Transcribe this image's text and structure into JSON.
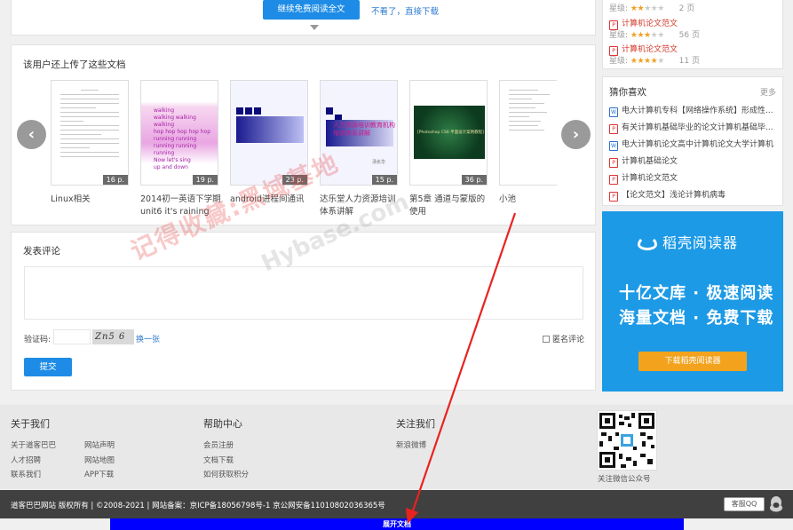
{
  "continue_panel": {
    "button_label": "继续免费阅读全文",
    "link_label": "不看了，直接下载"
  },
  "uploads": {
    "title": "该用户还上传了这些文档",
    "prev_label": "‹",
    "next_label": "›",
    "docs": [
      {
        "title": "Linux相关",
        "pages": "16 p."
      },
      {
        "title": "2014初一英语下学期unit6 it's raining",
        "pages": "19 p.",
        "thumb_text": "walking\nwalking walking walking\nhop hop hop hop hop\nrunning running\nrunning running running\nNow let's sing\nup and down"
      },
      {
        "title": "android进程间通讯",
        "pages": "23 p."
      },
      {
        "title": "达乐堂人力资源培训体系讲解",
        "pages": "15 p.",
        "thumb_text": "人力资源培训教育机构\n培训体系讲解",
        "thumb_sub": "汤长华"
      },
      {
        "title": "第5章 通道与蒙版的使用",
        "pages": "36 p.",
        "thumb_text": "[Photoshop CS6 平面设计案例教程]"
      },
      {
        "title": "小池",
        "pages": ""
      }
    ]
  },
  "comment": {
    "title": "发表评论",
    "captcha_label": "验证码:",
    "captcha_text": "Zn5 6",
    "refresh_label": "换一张",
    "anonymous_label": "匿名评论",
    "submit_label": "提交"
  },
  "right_top": {
    "items": [
      {
        "title": "",
        "rating_label": "星级:",
        "stars": 2,
        "pages": "2 页"
      },
      {
        "title": "计算机论文范文",
        "rating_label": "星级:",
        "stars": 3,
        "pages": "56 页"
      },
      {
        "title": "计算机论文范文",
        "rating_label": "星级:",
        "stars": 4,
        "pages": "11 页"
      }
    ]
  },
  "guess": {
    "title": "猜你喜欢",
    "more_label": "更多",
    "items": [
      {
        "type": "word",
        "title": "电大计算机专科【网络操作系统】形成性..."
      },
      {
        "type": "pdf",
        "title": "有关计算机基础毕业的论文计算机基础毕..."
      },
      {
        "type": "word",
        "title": "电大计算机论文高中计算机论文大学计算机"
      },
      {
        "type": "pdf",
        "title": "计算机基础论文"
      },
      {
        "type": "pdf",
        "title": "计算机论文范文"
      },
      {
        "type": "pdf",
        "title": "【论文范文】浅论计算机病毒"
      }
    ]
  },
  "ad": {
    "brand": "稻壳阅读器",
    "line1": "十亿文库 · 极速阅读",
    "line2": "海量文档 · 免费下载",
    "button_label": "下载稻壳阅读器"
  },
  "footer": {
    "about": {
      "heading": "关于我们",
      "links": [
        "关于道客巴巴",
        "网站声明",
        "人才招聘",
        "网站地图",
        "联系我们",
        "APP下载"
      ]
    },
    "help": {
      "heading": "帮助中心",
      "links": [
        "会员注册",
        "文档下载",
        "如何获取积分"
      ]
    },
    "follow": {
      "heading": "关注我们",
      "links": [
        "新浪微博"
      ]
    },
    "qr_label": "关注微信公众号"
  },
  "bottom_bar": {
    "copyright": "道客巴巴网站 版权所有  | ©2008-2021  |  网站备案：京ICP备18056798号-1  京公网安备11010802036365号",
    "kefu_label": "客服QQ"
  },
  "expand_label": "展开文档",
  "watermark": {
    "text1": "记得收藏:黑域基地",
    "text2": "Hybase.com"
  },
  "colors": {
    "accent": "#1e8ce6",
    "link": "#2e7bd0",
    "red_link": "#d23b2b",
    "ad_bg": "#1d9ae6",
    "ad_button": "#f3a21d",
    "expand_bar": "#0000ff",
    "annotation_arrow": "#e8231f"
  }
}
